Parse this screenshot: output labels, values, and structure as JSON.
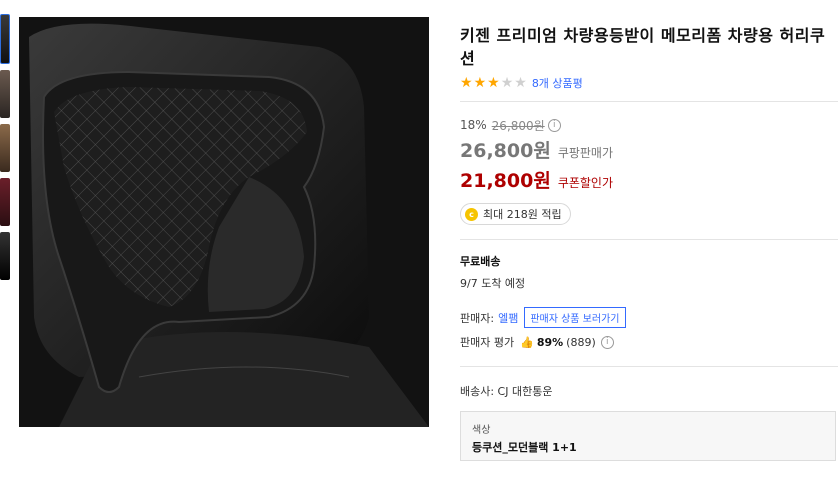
{
  "product": {
    "title": "키젠 프리미엄 차량용등받이 메모리폼 차량용 허리쿠션",
    "rating_stars": 3,
    "rating_max": 5,
    "review_count_text": "8개 상품평"
  },
  "pricing": {
    "discount_rate": "18%",
    "original_price": "26,800원",
    "info_symbol": "i",
    "coupang_price": "26,800원",
    "coupang_price_label": "쿠팡판매가",
    "coupon_price": "21,800원",
    "coupon_price_label": "쿠폰할인가",
    "reward_icon": "c",
    "reward_text": "최대 218원 적립"
  },
  "shipping": {
    "label": "무료배송",
    "eta": "9/7 도착 예정"
  },
  "seller": {
    "label": "판매자:",
    "name": "엘팸",
    "view_products_btn": "판매자 상품 보러가기",
    "rating_label": "판매자 평가",
    "rating_percent": "89%",
    "rating_count": "(889)"
  },
  "carrier": {
    "text": "배송사: CJ 대한통운"
  },
  "option": {
    "label": "색상",
    "value": "등쿠션_모던블랙 1+1"
  },
  "colors": {
    "link_blue": "#346aff",
    "coupon_red": "#ae0000",
    "star_orange": "#ffa600"
  }
}
